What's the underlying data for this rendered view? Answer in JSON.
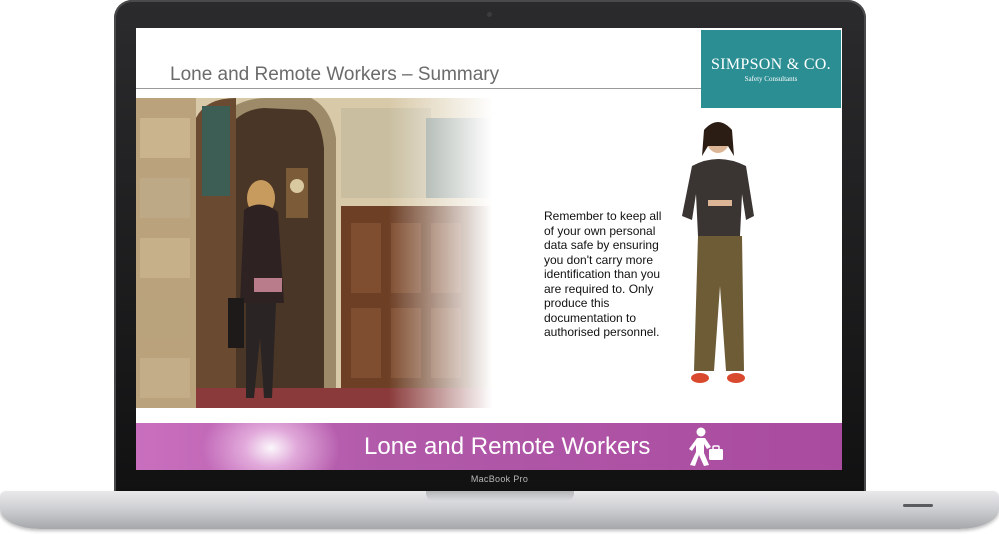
{
  "device": {
    "brand_label": "MacBook Pro"
  },
  "slide": {
    "title": "Lone and Remote Workers – Summary",
    "logo": {
      "name": "SIMPSON & CO.",
      "tagline": "Safety Consultants",
      "color": "#2b8e93"
    },
    "body_text": "Remember to keep all of your own personal data safe by ensuring you don't carry more identification than you are required to. Only produce this documentation to authorised personnel.",
    "photo": {
      "description_icon": "woman-entering-doorway-photo"
    },
    "presenter": {
      "icon": "presenter-figure"
    }
  },
  "footer": {
    "title": "Lone and Remote Workers",
    "icon": "walking-worker-with-briefcase-icon",
    "color": "#b25aaa"
  }
}
